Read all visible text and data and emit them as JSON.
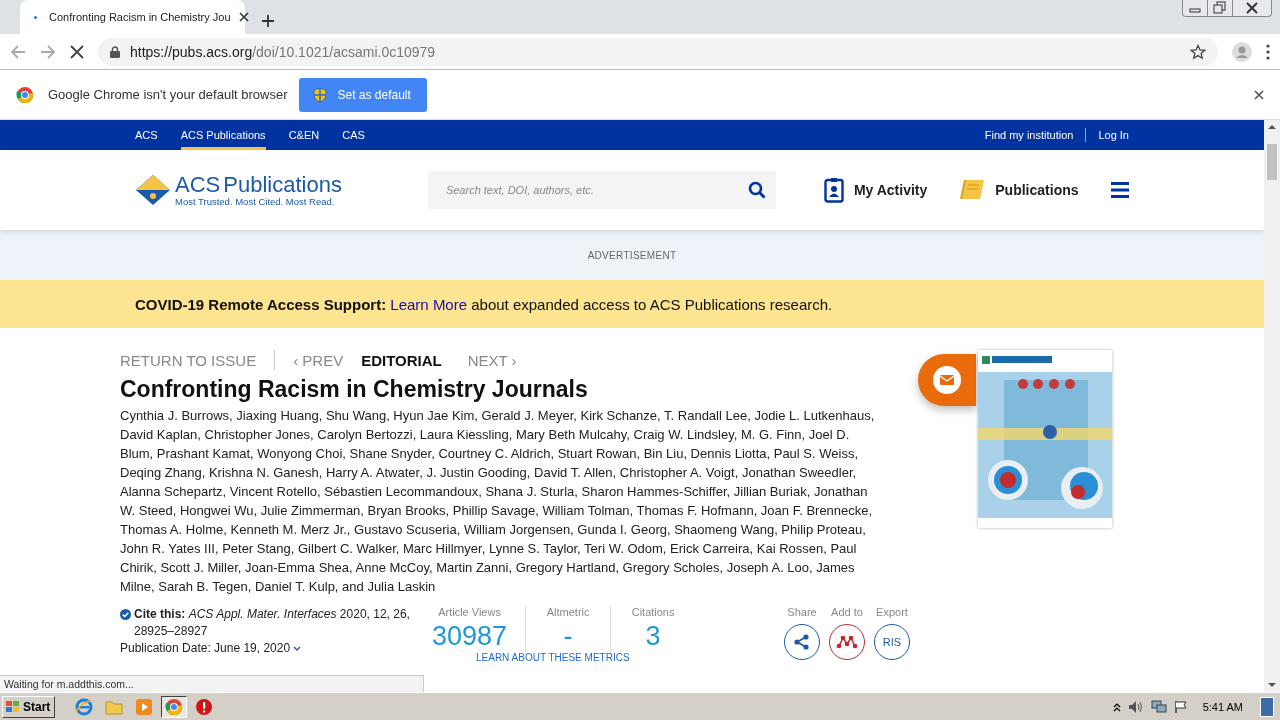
{
  "browser": {
    "tab": {
      "title": "Confronting Racism in Chemistry Jou"
    },
    "url_host": "https://pubs.acs.org",
    "url_path": "/doi/10.1021/acsami.0c10979"
  },
  "infobar": {
    "message": "Google Chrome isn't your default browser",
    "button": "Set as default"
  },
  "top_nav": {
    "items": [
      {
        "label": "ACS",
        "selected": false
      },
      {
        "label": "ACS Publications",
        "selected": true
      },
      {
        "label": "C&EN",
        "selected": false
      },
      {
        "label": "CAS",
        "selected": false
      }
    ],
    "right": [
      "Find my institution",
      "Log In"
    ]
  },
  "header": {
    "logo_acs": "ACS",
    "logo_word": "Publications",
    "tagline": "Most Trusted. Most Cited. Most Read.",
    "search_placeholder": "Search text, DOI, authors, etc.",
    "links": [
      {
        "label": "My Activity",
        "kind": "activity"
      },
      {
        "label": "Publications",
        "kind": "book"
      }
    ]
  },
  "advertisement_label": "ADVERTISEMENT",
  "banner": {
    "lead": "COVID-19 Remote Access Support:",
    "link": "Learn More",
    "rest": "about expanded access to ACS Publications research."
  },
  "article": {
    "nav": [
      {
        "label": "RETURN TO ISSUE",
        "kind": "link"
      },
      {
        "label": "‹ PREV",
        "kind": "link"
      },
      {
        "label": "EDITORIAL",
        "kind": "type"
      },
      {
        "label": "NEXT ›",
        "kind": "link"
      }
    ],
    "title": "Confronting Racism in Chemistry Journals",
    "authors": "Cynthia J. Burrows, Jiaxing Huang, Shu Wang, Hyun Jae Kim, Gerald J. Meyer, Kirk Schanze, T. Randall Lee, Jodie L. Lutkenhaus, David Kaplan, Christopher Jones, Carolyn Bertozzi, Laura Kiessling, Mary Beth Mulcahy, Craig W. Lindsley, M. G. Finn, Joel D. Blum, Prashant Kamat, Wonyong Choi, Shane Snyder, Courtney C. Aldrich, Stuart Rowan, Bin Liu, Dennis Liotta, Paul S. Weiss, Deqing Zhang, Krishna N. Ganesh, Harry A. Atwater, J. Justin Gooding, David T. Allen, Christopher A. Voigt, Jonathan Sweedler, Alanna Schepartz, Vincent Rotello, Sébastien Lecommandoux, Shana J. Sturla, Sharon Hammes-Schiffer, Jillian Buriak, Jonathan W. Steed, Hongwei Wu, Julie Zimmerman, Bryan Brooks, Phillip Savage, William Tolman, Thomas F. Hofmann, Joan F. Brennecke, Thomas A. Holme, Kenneth M. Merz Jr., Gustavo Scuseria, William Jorgensen, Gunda I. Georg, Shaomeng Wang, Philip Proteau, John R. Yates III, Peter Stang, Gilbert C. Walker, Marc Hillmyer, Lynne S. Taylor, Teri W. Odom, Erick Carreira, Kai Rossen, Paul Chirik, Scott J. Miller, Joan-Emma Shea, Anne McCoy, Martin Zanni, Gregory Hartland, Gregory Scholes, Joseph A. Loo, James Milne, Sarah B. Tegen, Daniel T. Kulp, and Julia Laskin",
    "cite": "**Cite this:** *ACS Appl. Mater. Interfaces* 2020, 12, 26, 28925–28927",
    "publication_date": "Publication Date: June 19, 2020",
    "metrics": [
      {
        "label": "Article Views",
        "value": "30987"
      },
      {
        "label": "Altmetric",
        "value": "-"
      },
      {
        "label": "Citations",
        "value": "3"
      }
    ],
    "metrics_link": "LEARN ABOUT THESE METRICS",
    "actions": [
      {
        "label": "Share",
        "kind": "share"
      },
      {
        "label": "Add to",
        "kind": "mendeley"
      },
      {
        "label": "Export",
        "kind": "ris",
        "button_text": "RIS"
      }
    ]
  },
  "status_text": "Waiting for m.addthis.com...",
  "taskbar": {
    "start": "Start",
    "apps": [
      {
        "kind": "ie",
        "selected": false
      },
      {
        "kind": "folder",
        "selected": false
      },
      {
        "kind": "media",
        "selected": false
      },
      {
        "kind": "chrome",
        "selected": true
      },
      {
        "kind": "stop",
        "selected": false
      }
    ],
    "time": "5:41 AM"
  }
}
